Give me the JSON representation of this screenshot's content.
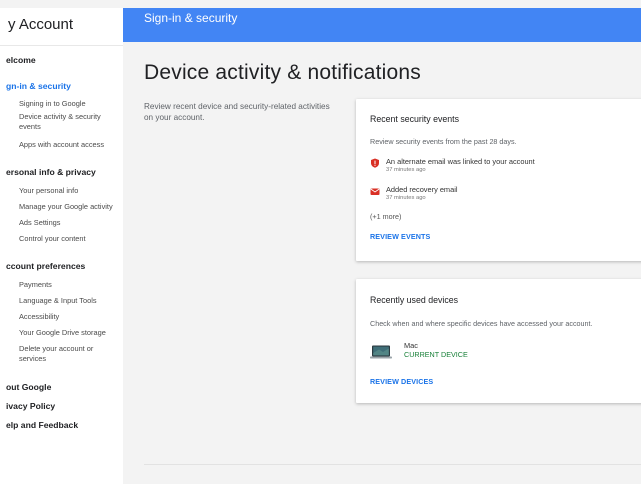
{
  "sidebar": {
    "title": "y Account",
    "sections": [
      {
        "label": "elcome",
        "active": false,
        "items": []
      },
      {
        "label": "gn-in & security",
        "active": true,
        "items": [
          "Signing in to Google",
          "Device activity & security events",
          "Apps with account access"
        ]
      },
      {
        "label": "ersonal info & privacy",
        "active": false,
        "items": [
          "Your personal info",
          "Manage your Google activity",
          "Ads Settings",
          "Control your content"
        ]
      },
      {
        "label": "ccount preferences",
        "active": false,
        "items": [
          "Payments",
          "Language & Input Tools",
          "Accessibility",
          "Your Google Drive storage",
          "Delete your account or services"
        ]
      },
      {
        "label": "out Google",
        "active": false,
        "items": []
      },
      {
        "label": "ivacy Policy",
        "active": false,
        "items": []
      },
      {
        "label": "elp and Feedback",
        "active": false,
        "items": []
      }
    ]
  },
  "topbar": {
    "title": "Sign-in & security"
  },
  "main": {
    "title": "Device activity & notifications",
    "description": "Review recent device and security-related activities on your account."
  },
  "security_card": {
    "title": "Recent security events",
    "subtitle": "Review security events from the past 28 days.",
    "events": [
      {
        "title": "An alternate email was linked to your account",
        "time": "37 minutes ago",
        "icon": "shield-alert-icon"
      },
      {
        "title": "Added recovery email",
        "time": "37 minutes ago",
        "icon": "mail-alert-icon"
      }
    ],
    "more": "(+1 more)",
    "action": "REVIEW EVENTS"
  },
  "devices_card": {
    "title": "Recently used devices",
    "subtitle": "Check when and where specific devices have accessed your account.",
    "device": {
      "name": "Mac",
      "status": "CURRENT DEVICE",
      "icon": "laptop-icon"
    },
    "action": "REVIEW DEVICES"
  },
  "colors": {
    "accent": "#4285f4",
    "link": "#1a73e8",
    "alert": "#d93025",
    "current": "#188038"
  }
}
